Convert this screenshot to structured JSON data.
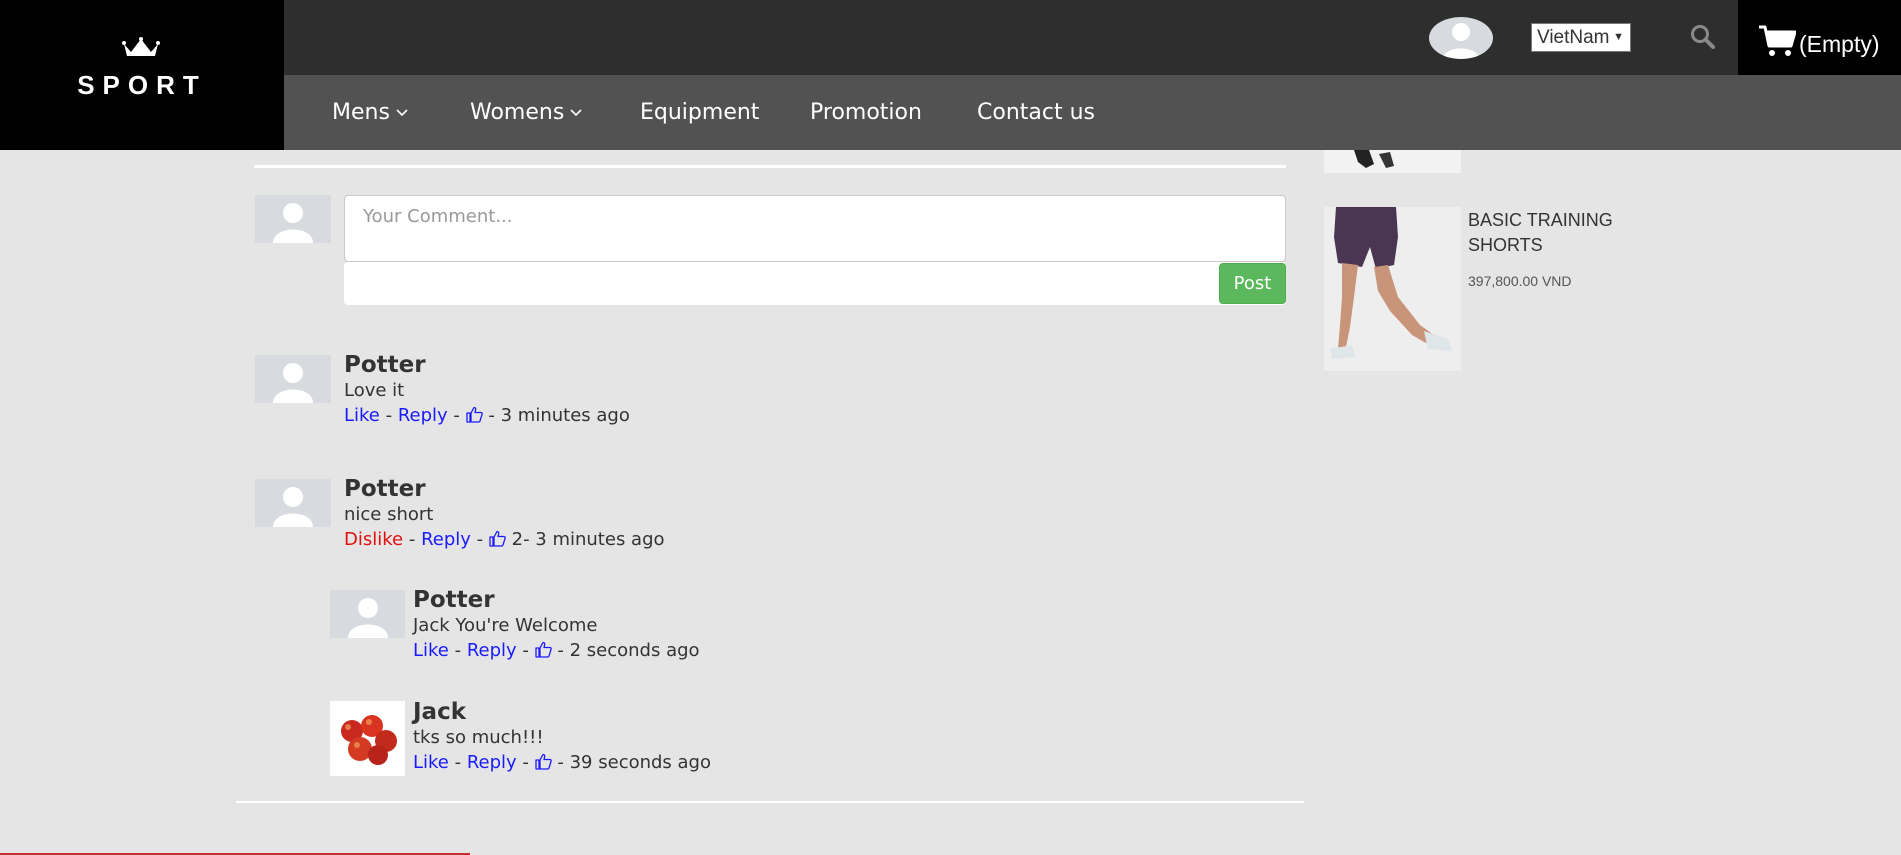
{
  "brand": {
    "logo_text": "SPORT"
  },
  "header": {
    "country_select": {
      "value": "VietNam"
    },
    "cart": {
      "label": "(Empty)"
    },
    "nav": [
      {
        "label": "Mens",
        "has_dropdown": true
      },
      {
        "label": "Womens",
        "has_dropdown": true
      },
      {
        "label": "Equipment"
      },
      {
        "label": "Promotion"
      },
      {
        "label": "Contact us"
      }
    ]
  },
  "comment_form": {
    "placeholder": "Your Comment...",
    "post_label": "Post"
  },
  "comments": [
    {
      "author": "Potter",
      "text": "Love it",
      "action_label": "Like",
      "reply_label": "Reply",
      "likes": "",
      "time": "3 minutes ago"
    },
    {
      "author": "Potter",
      "text": "nice short",
      "action_label": "Dislike",
      "reply_label": "Reply",
      "likes": "2",
      "time": "3 minutes ago",
      "replies": [
        {
          "author": "Potter",
          "text": "Jack You're Welcome",
          "action_label": "Like",
          "reply_label": "Reply",
          "likes": "",
          "time": "2 seconds ago"
        },
        {
          "author": "Jack",
          "text": "tks so much!!!",
          "action_label": "Like",
          "reply_label": "Reply",
          "likes": "",
          "time": "39 seconds ago"
        }
      ]
    }
  ],
  "sidebar": {
    "products": [
      {
        "title": "BASIC TRAINING SHORTS",
        "price": "397,800.00 VND"
      }
    ]
  },
  "colors": {
    "link": "#1a1aff",
    "dislike": "#e01010",
    "post_button": "#5cb85c",
    "topbar": "#2e2e2e",
    "navbar": "#525252",
    "page_bg": "#e5e5e5"
  },
  "icons": [
    "crown-icon",
    "chevron-down-icon",
    "user-avatar-icon",
    "search-icon",
    "cart-icon",
    "thumbs-up-icon"
  ]
}
